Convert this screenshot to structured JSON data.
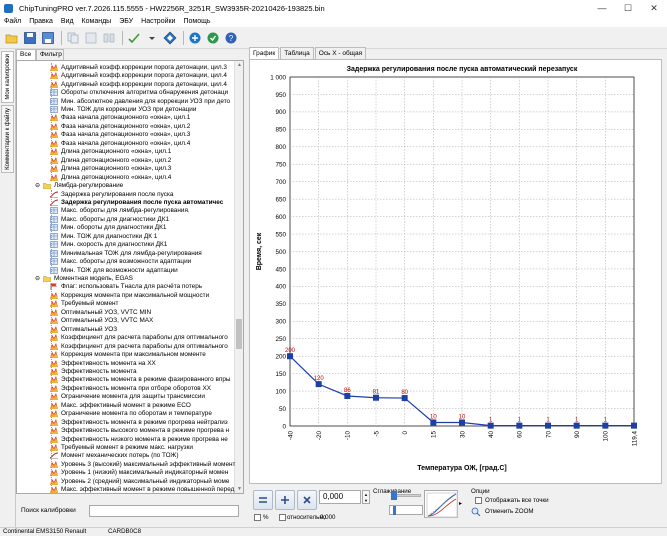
{
  "window": {
    "title": "ChipTuningPRO ver.7.2026.115.5555 - HW2256R_3251R_SW3935R-20210426-193825.bin",
    "controls": [
      "—",
      "☐",
      "✕"
    ]
  },
  "menu": [
    "Файл",
    "Правка",
    "Вид",
    "Команды",
    "ЭБУ",
    "Настройки",
    "Помощь"
  ],
  "vertical_tabs": [
    "Мои калибровки",
    "Комментарии к файлу"
  ],
  "tree": {
    "tabs": [
      "Все",
      "Фильтр"
    ],
    "rows": [
      {
        "label": "Аддитивный коэфф.коррекции порога детонации, цил.3",
        "icon": "map-3d-icon",
        "indent": 1
      },
      {
        "label": "Аддитивный коэфф.коррекции порога детонации, цил.4",
        "icon": "map-3d-icon",
        "indent": 1
      },
      {
        "label": "Аддитивный коэфф.коррекции порога детонации, цил.4",
        "icon": "map-3d-icon",
        "indent": 1
      },
      {
        "label": "Обороты отключения алгоритма обнаружения детонаци",
        "icon": "table-icon",
        "indent": 1
      },
      {
        "label": "Мин. абсолютное давления для коррекции УОЗ при дето",
        "icon": "table-icon",
        "indent": 1
      },
      {
        "label": "Мин. ТОЖ для коррекции УОЗ при детонации",
        "icon": "table-icon",
        "indent": 1
      },
      {
        "label": "Фаза начала детонационного «окна», цил.1",
        "icon": "map-3d-icon",
        "indent": 1
      },
      {
        "label": "Фаза начала детонационного «окна», цил.2",
        "icon": "map-3d-icon",
        "indent": 1
      },
      {
        "label": "Фаза начала детонационного «окна», цил.3",
        "icon": "map-3d-icon",
        "indent": 1
      },
      {
        "label": "Фаза начала детонационного «окна», цил.4",
        "icon": "map-3d-icon",
        "indent": 1
      },
      {
        "label": "Длина детонационного «окна», цил.1",
        "icon": "map-3d-icon",
        "indent": 1
      },
      {
        "label": "Длина детонационного «окна», цил.2",
        "icon": "map-3d-icon",
        "indent": 1
      },
      {
        "label": "Длина детонационного «окна», цил.3",
        "icon": "map-3d-icon",
        "indent": 1
      },
      {
        "label": "Длина детонационного «окна», цил.4",
        "icon": "map-3d-icon",
        "indent": 1
      },
      {
        "label": "Лямбда-регулирование",
        "icon": "folder-icon",
        "indent": 0,
        "folder": true
      },
      {
        "label": "Задержка регулирования после пуска",
        "icon": "curve-icon",
        "indent": 1
      },
      {
        "label": "Задержка регулирования после пуска автоматичес",
        "icon": "curve-icon",
        "indent": 1,
        "selected": true
      },
      {
        "label": "Макс. обороты для лямбда-регулирования.",
        "icon": "table-icon",
        "indent": 1
      },
      {
        "label": "Макс. обороты для диагностики ДК1",
        "icon": "table-icon",
        "indent": 1
      },
      {
        "label": "Мин. обороты для диагностики ДК1",
        "icon": "table-icon",
        "indent": 1
      },
      {
        "label": "Мин. ТОЖ для диагностики ДК 1",
        "icon": "table-icon",
        "indent": 1
      },
      {
        "label": "Мин. скорость для диагностики ДК1",
        "icon": "table-icon",
        "indent": 1
      },
      {
        "label": "Минимальная ТОЖ для лямбда-регулирования",
        "icon": "table-icon",
        "indent": 1
      },
      {
        "label": "Макс. обороты для возможности адаптации",
        "icon": "table-icon",
        "indent": 1
      },
      {
        "label": "Мин. ТОЖ для возможности адаптации",
        "icon": "table-icon",
        "indent": 1
      },
      {
        "label": "Моментная модель, EGAS",
        "icon": "folder-icon",
        "indent": 0,
        "folder": true
      },
      {
        "label": "Флаг: использовать Тнасла для расчёта потерь",
        "icon": "flag-icon",
        "indent": 1
      },
      {
        "label": "Коррекция момента при максимальной мощности",
        "icon": "map-3d-icon",
        "indent": 1
      },
      {
        "label": "Требуемый момент",
        "icon": "map-3d-icon",
        "indent": 1
      },
      {
        "label": "Оптимальный УОЗ, VVTC MIN",
        "icon": "map-3d-icon",
        "indent": 1
      },
      {
        "label": "Оптимальный УОЗ, VVTC MAX",
        "icon": "map-3d-icon",
        "indent": 1
      },
      {
        "label": "Оптимальный УОЗ",
        "icon": "map-3d-icon",
        "indent": 1
      },
      {
        "label": "Коэффициент для расчета параболы для оптимального",
        "icon": "map-3d-icon",
        "indent": 1
      },
      {
        "label": "Коэффициент для расчета параболы для оптимального",
        "icon": "map-3d-icon",
        "indent": 1
      },
      {
        "label": "Коррекция момента при максимальном моменте",
        "icon": "map-3d-icon",
        "indent": 1
      },
      {
        "label": "Эффективность момента на XX",
        "icon": "map-3d-icon",
        "indent": 1
      },
      {
        "label": "Эффективность момента",
        "icon": "map-3d-icon",
        "indent": 1
      },
      {
        "label": "Эффективность момента в режиме фазированного впры",
        "icon": "map-3d-icon",
        "indent": 1
      },
      {
        "label": "Эффективность момента при отборе оборотов XX",
        "icon": "map-3d-icon",
        "indent": 1
      },
      {
        "label": "Ограничение момента для защиты трансмиссии",
        "icon": "map-3d-icon",
        "indent": 1
      },
      {
        "label": "Макс. эффективный момент в режиме ECO",
        "icon": "map-3d-icon",
        "indent": 1
      },
      {
        "label": "Ограничение момента по оборотам и температуре",
        "icon": "map-3d-icon",
        "indent": 1
      },
      {
        "label": "Эффективность момента в режиме прогрева нейтрализ",
        "icon": "map-3d-icon",
        "indent": 1
      },
      {
        "label": "Эффективность высокого момента в режиме прогрева н",
        "icon": "map-3d-icon",
        "indent": 1
      },
      {
        "label": "Эффективность низкого момента в режиме прогрева не",
        "icon": "map-3d-icon",
        "indent": 1
      },
      {
        "label": "Требуемый момент в режиме макс. нагрузки",
        "icon": "map-3d-icon",
        "indent": 1
      },
      {
        "label": "Момент механических потерь (по ТОЖ)",
        "icon": "curve-icon",
        "indent": 1
      },
      {
        "label": "Уровень 3 (высокий) максимальный эффективный момент",
        "icon": "map-3d-icon",
        "indent": 1
      },
      {
        "label": "Уровень 1 (низкий) максимальный индикаторный момен",
        "icon": "map-3d-icon",
        "indent": 1
      },
      {
        "label": "Уровень 2 (средний) максимальный индикаторный моме",
        "icon": "map-3d-icon",
        "indent": 1
      },
      {
        "label": "Макс. эффективный момент в режиме повышенной перед",
        "icon": "map-3d-icon",
        "indent": 1
      }
    ],
    "search_label": "Поиск калибровки",
    "search_value": ""
  },
  "right_tabs": [
    "График",
    "Таблица",
    "Ось X - общая"
  ],
  "chart_data": {
    "type": "line",
    "title": "Задержка регулирования после пуска автоматический перезапуск",
    "xlabel": "Температура ОЖ, [град.С]",
    "ylabel": "Время, сек",
    "categories": [
      "-40",
      "-20",
      "-10",
      "-5",
      "0",
      "15",
      "30",
      "40",
      "60",
      "70",
      "90",
      "100",
      "119,4"
    ],
    "values": [
      200,
      120,
      86,
      81,
      80,
      10,
      10,
      1,
      1,
      1,
      1,
      1,
      1
    ],
    "point_labels": [
      "200",
      "120",
      "86",
      "81",
      "80",
      "10",
      "10",
      "1",
      "1",
      "1",
      "1",
      "1",
      ""
    ],
    "y_ticks": [
      "1 000",
      "950",
      "900",
      "850",
      "800",
      "750",
      "700",
      "650",
      "600",
      "550",
      "500",
      "450",
      "400",
      "350",
      "300",
      "250",
      "200",
      "150",
      "100",
      "50",
      "0"
    ],
    "ylim": [
      0,
      1000
    ],
    "grid": true,
    "series_color": "#1f3fa8",
    "label_color": "#c00000"
  },
  "bottom": {
    "value": "0,000",
    "percent_label": "%",
    "relative_label": "относительно",
    "relative_value": "0,000",
    "smoothing_label": "Сглаживание",
    "options_label": "Опции",
    "show_all_points": "Отображать все точки",
    "reset_zoom": "Отменить ZOOM"
  },
  "status": {
    "ecu": "Continental EMS3150 Renault",
    "checksum": "CARDB0C8"
  }
}
